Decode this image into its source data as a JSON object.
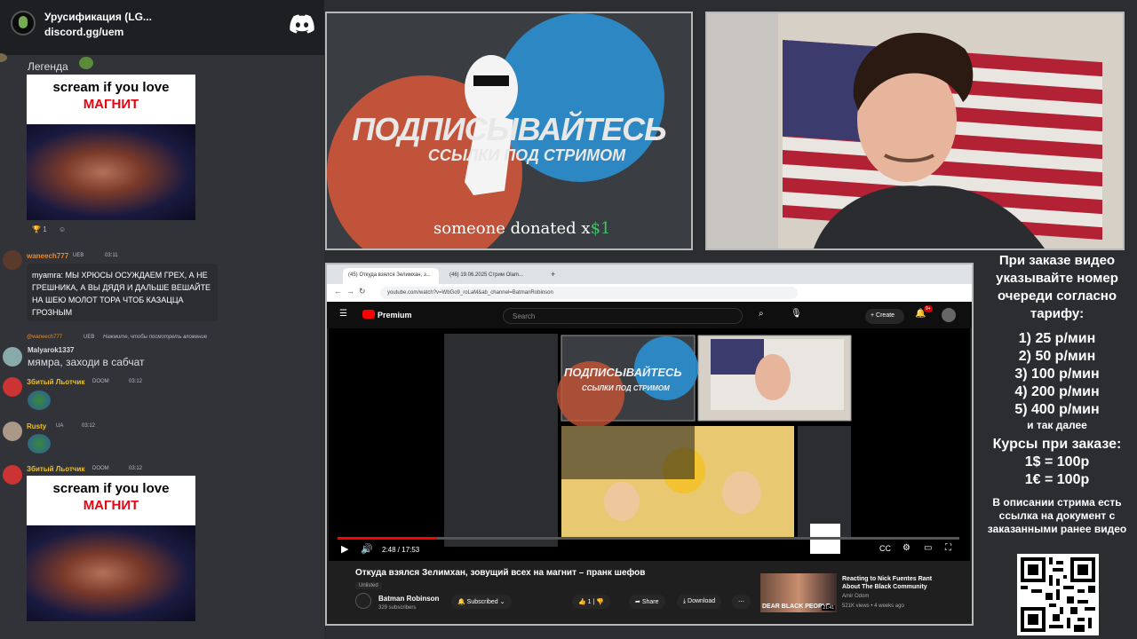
{
  "server": {
    "name": "Урусификация (LG...",
    "invite": "discord.gg/uem"
  },
  "messages": {
    "legend": "Легенда",
    "gif_line1": "scream if you love",
    "gif_line2": "МАГНИТ",
    "reaction1_count": "1",
    "user1": "waneech777",
    "user1_badge": "UEB",
    "user1_time": "03:11",
    "quote_text": "myamra: МЫ ХРЮСЫ ОСУЖДАЕМ ГРЕХ, А НЕ ГРЕШНИКА, А ВЫ ДЯДЯ И ДАЛЬШЕ ВЕШАЙТЕ НА ШЕЮ МОЛОТ ТОРА ЧТОБ КАЗАЦЦА ГРОЗНЫМ",
    "reply_user": "@waneech777",
    "reply_badge": "UEB",
    "reply_text": "Нажмите, чтобы посмотреть вложение",
    "user2": "Malyarok1337",
    "user2_text": "мямра, заходи в сабчат",
    "user3": "Збитый Льотчик",
    "user3_badge": "DOOM",
    "user3_time": "03:12",
    "user4": "Rusty",
    "user4_badge": "UA",
    "user4_time": "03:12",
    "user5": "Збитый Льотчик",
    "user5_badge": "DOOM",
    "user5_time": "03:12"
  },
  "banner": {
    "title": "ПОДПИСЫВАЙТЕСЬ",
    "subtitle": "ССЫЛКИ ПОД СТРИМОМ",
    "donation_text": "someone donated x",
    "donation_amount": "$1"
  },
  "browser": {
    "tab1": "(45) Откуда взялся Зелимхан, з...",
    "tab2": "(46) 19.06.2025 Стрим Olam...",
    "url": "youtube.com/watch?v=WbGo9_roLaM&ab_channel=BatmanRobinson",
    "yt_logo": "Premium",
    "search_placeholder": "Search",
    "create": "Create",
    "notif_badge": "9+",
    "time": "2:48 / 17:53",
    "progress": 0.16,
    "title": "Откуда взялся Зелимхан, зовущий всех на магнит – пранк шефов",
    "unlisted": "Unlisted",
    "channel": "Batman Robinson",
    "subs": "329 subscribers",
    "subscribed": "Subscribed",
    "likes": "1",
    "share": "Share",
    "download": "Download",
    "rec_title": "Reacting to Nick Fuentes Rant About The Black Community",
    "rec_channel": "Amir Odom",
    "rec_meta": "521K views • 4 weeks ago",
    "rec_thumb_text": "DEAR BLACK PEOPLE",
    "rec_duration": "21:41"
  },
  "prices": {
    "header": "При заказе видео указывайте номер очереди согласно тарифу:",
    "tiers": [
      "1) 25 р/мин",
      "2) 50 р/мин",
      "3) 100 р/мин",
      "4) 200 р/мин",
      "5) 400 р/мин"
    ],
    "etc": "и так далее",
    "rates_header": "Курсы при заказе:",
    "rate1": "1$ = 100р",
    "rate2": "1€ = 100р",
    "footer": "В описании стрима есть ссылка на документ с заказанными ранее видео"
  }
}
